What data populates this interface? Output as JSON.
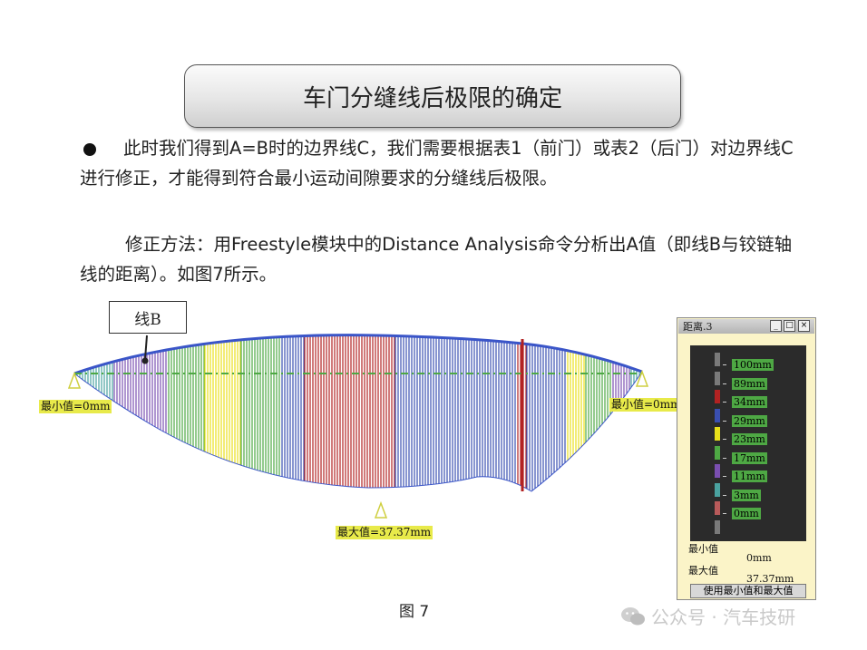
{
  "slide": {
    "title": "车门分缝线后极限的确定",
    "para1": "此时我们得到A=B时的边界线C，我们需要根据表1（前门）或表2（后门）对边界线C进行修正，才能得到符合最小运动间隙要求的分缝线后极限。",
    "para2": "修正方法：用Freestyle模块中的Distance Analysis命令分析出A值（即线B与铰链轴线的距离）。如图7所示。",
    "caption": "图 7"
  },
  "figure": {
    "line_label": "线B",
    "min_left": "最小值=0mm",
    "min_right": "最小值=0mm",
    "max_label": "最大值=37.37mm"
  },
  "panel": {
    "title": "距离.3",
    "legend": [
      {
        "label": "100mm",
        "color": "#7a7a7a"
      },
      {
        "label": "89mm",
        "color": "#7a7a7a"
      },
      {
        "label": "34mm",
        "color": "#b22222"
      },
      {
        "label": "29mm",
        "color": "#3a4fb0"
      },
      {
        "label": "23mm",
        "color": "#e8e01a"
      },
      {
        "label": "17mm",
        "color": "#4ea844"
      },
      {
        "label": "11mm",
        "color": "#7a4fb0"
      },
      {
        "label": "3mm",
        "color": "#4aa2a0"
      },
      {
        "label": "0mm",
        "color": "#b85a5a"
      }
    ],
    "last_swatch_color": "#7a7a7a",
    "min_label": "最小值",
    "min_value": "0mm",
    "max_label": "最大值",
    "max_value": "37.37mm",
    "button_label": "使用最小值和最大值"
  },
  "watermark": "公众号 · 汽车技研"
}
